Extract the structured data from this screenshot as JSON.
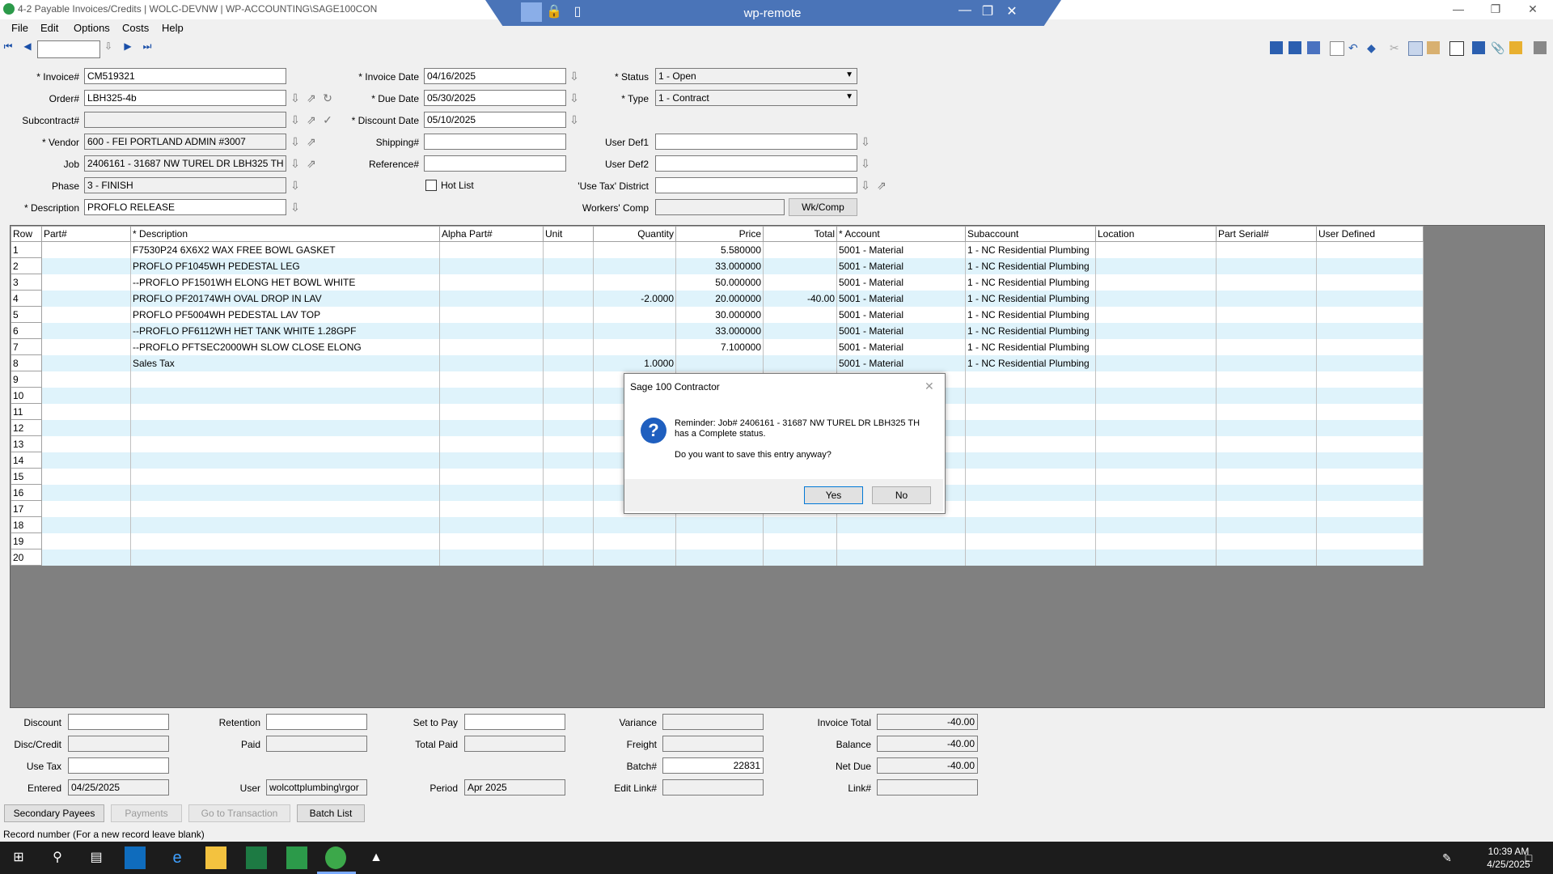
{
  "window": {
    "title": "4-2 Payable Invoices/Credits  |  WOLC-DEVNW  |  WP-ACCOUNTING\\SAGE100CON",
    "remote_title": "wp-remote"
  },
  "menu": [
    "File",
    "Edit",
    "Options",
    "Costs",
    "Help"
  ],
  "icons": {
    "app": "sage-app-icon",
    "nav_first": "first-record-icon",
    "nav_prev": "prev-record-icon",
    "nav_next": "next-record-icon",
    "nav_last": "last-record-icon",
    "lookup": "down-arrow-lookup-icon",
    "accent_color": "#1f5fbf",
    "row_alt_color": "#dff3fb"
  },
  "form": {
    "invoice": {
      "label": "* Invoice#",
      "value": "CM519321"
    },
    "order": {
      "label": "Order#",
      "value": "LBH325-4b"
    },
    "subcontract": {
      "label": "Subcontract#",
      "value": ""
    },
    "vendor": {
      "label": "* Vendor",
      "value": "600 - FEI PORTLAND ADMIN #3007"
    },
    "job": {
      "label": "Job",
      "value": "2406161 - 31687 NW TUREL DR  LBH325 TH"
    },
    "phase": {
      "label": "Phase",
      "value": "3 - FINISH"
    },
    "description": {
      "label": "* Description",
      "value": "PROFLO RELEASE"
    },
    "invoice_date": {
      "label": "* Invoice Date",
      "value": "04/16/2025"
    },
    "due_date": {
      "label": "* Due Date",
      "value": "05/30/2025"
    },
    "discount_date": {
      "label": "* Discount Date",
      "value": "05/10/2025"
    },
    "shipping": {
      "label": "Shipping#",
      "value": ""
    },
    "reference": {
      "label": "Reference#",
      "value": ""
    },
    "hot_list": {
      "label": "Hot List",
      "checked": false
    },
    "status": {
      "label": "* Status",
      "value": "1 - Open"
    },
    "type": {
      "label": "* Type",
      "value": "1 - Contract"
    },
    "user_def1": {
      "label": "User Def1",
      "value": ""
    },
    "user_def2": {
      "label": "User Def2",
      "value": ""
    },
    "use_tax_district": {
      "label": "'Use Tax' District",
      "value": ""
    },
    "workers_comp": {
      "label": "Workers' Comp",
      "value": ""
    },
    "wkcomp_button": "Wk/Comp"
  },
  "grid": {
    "columns": [
      "Row",
      "Part#",
      "* Description",
      "Alpha Part#",
      "Unit",
      "Quantity",
      "Price",
      "Total",
      "* Account",
      "Subaccount",
      "Location",
      "Part Serial#",
      "User Defined"
    ],
    "rows": [
      [
        "1",
        "",
        "F7530P24 6X6X2 WAX FREE BOWL GASKET",
        "",
        "",
        "",
        "5.580000",
        "",
        "5001 - Material",
        "1 - NC Residential Plumbing",
        "",
        "",
        ""
      ],
      [
        "2",
        "",
        "PROFLO PF1045WH PEDESTAL LEG",
        "",
        "",
        "",
        "33.000000",
        "",
        "5001 - Material",
        "1 - NC Residential Plumbing",
        "",
        "",
        ""
      ],
      [
        "3",
        "",
        "--PROFLO PF1501WH ELONG HET BOWL WHITE",
        "",
        "",
        "",
        "50.000000",
        "",
        "5001 - Material",
        "1 - NC Residential Plumbing",
        "",
        "",
        ""
      ],
      [
        "4",
        "",
        "PROFLO PF20174WH OVAL DROP IN LAV",
        "",
        "",
        "-2.0000",
        "20.000000",
        "-40.00",
        "5001 - Material",
        "1 - NC Residential Plumbing",
        "",
        "",
        ""
      ],
      [
        "5",
        "",
        "PROFLO PF5004WH PEDESTAL LAV TOP",
        "",
        "",
        "",
        "30.000000",
        "",
        "5001 - Material",
        "1 - NC Residential Plumbing",
        "",
        "",
        ""
      ],
      [
        "6",
        "",
        "--PROFLO PF6112WH HET TANK WHITE 1.28GPF",
        "",
        "",
        "",
        "33.000000",
        "",
        "5001 - Material",
        "1 - NC Residential Plumbing",
        "",
        "",
        ""
      ],
      [
        "7",
        "",
        "--PROFLO PFTSEC2000WH SLOW CLOSE ELONG",
        "",
        "",
        "",
        "7.100000",
        "",
        "5001 - Material",
        "1 - NC Residential Plumbing",
        "",
        "",
        ""
      ],
      [
        "8",
        "",
        "Sales Tax",
        "",
        "",
        "1.0000",
        "",
        "",
        "5001 - Material",
        "1 - NC Residential Plumbing",
        "",
        "",
        ""
      ],
      [
        "9",
        "",
        "",
        "",
        "",
        "",
        "",
        "",
        "",
        "",
        "",
        "",
        ""
      ],
      [
        "10",
        "",
        "",
        "",
        "",
        "",
        "",
        "",
        "",
        "",
        "",
        "",
        ""
      ],
      [
        "11",
        "",
        "",
        "",
        "",
        "",
        "",
        "",
        "",
        "",
        "",
        "",
        ""
      ],
      [
        "12",
        "",
        "",
        "",
        "",
        "",
        "",
        "",
        "",
        "",
        "",
        "",
        ""
      ],
      [
        "13",
        "",
        "",
        "",
        "",
        "",
        "",
        "",
        "",
        "",
        "",
        "",
        ""
      ],
      [
        "14",
        "",
        "",
        "",
        "",
        "",
        "",
        "",
        "",
        "",
        "",
        "",
        ""
      ],
      [
        "15",
        "",
        "",
        "",
        "",
        "",
        "",
        "",
        "",
        "",
        "",
        "",
        ""
      ],
      [
        "16",
        "",
        "",
        "",
        "",
        "",
        "",
        "",
        "",
        "",
        "",
        "",
        ""
      ],
      [
        "17",
        "",
        "",
        "",
        "",
        "",
        "",
        "",
        "",
        "",
        "",
        "",
        ""
      ],
      [
        "18",
        "",
        "",
        "",
        "",
        "",
        "",
        "",
        "",
        "",
        "",
        "",
        ""
      ],
      [
        "19",
        "",
        "",
        "",
        "",
        "",
        "",
        "",
        "",
        "",
        "",
        "",
        ""
      ],
      [
        "20",
        "",
        "",
        "",
        "",
        "",
        "",
        "",
        "",
        "",
        "",
        "",
        ""
      ]
    ]
  },
  "dialog": {
    "title": "Sage 100 Contractor",
    "message_line1": "Reminder: Job# 2406161 - 31687 NW TUREL DR  LBH325 TH",
    "message_line2": "has a Complete status.",
    "question": "Do you want to save this entry anyway?",
    "yes": "Yes",
    "no": "No"
  },
  "totals": {
    "discount": {
      "label": "Discount",
      "value": ""
    },
    "disc_credit": {
      "label": "Disc/Credit",
      "value": ""
    },
    "use_tax": {
      "label": "Use Tax",
      "value": ""
    },
    "entered": {
      "label": "Entered",
      "value": "04/25/2025"
    },
    "retention": {
      "label": "Retention",
      "value": ""
    },
    "paid": {
      "label": "Paid",
      "value": ""
    },
    "user": {
      "label": "User",
      "value": "wolcottplumbing\\rgor"
    },
    "set_to_pay": {
      "label": "Set to Pay",
      "value": ""
    },
    "total_paid": {
      "label": "Total Paid",
      "value": ""
    },
    "period": {
      "label": "Period",
      "value": "Apr 2025"
    },
    "variance": {
      "label": "Variance",
      "value": ""
    },
    "freight": {
      "label": "Freight",
      "value": ""
    },
    "batch": {
      "label": "Batch#",
      "value": "22831"
    },
    "edit_link": {
      "label": "Edit Link#",
      "value": ""
    },
    "invoice_total": {
      "label": "Invoice Total",
      "value": "-40.00"
    },
    "balance": {
      "label": "Balance",
      "value": "-40.00"
    },
    "net_due": {
      "label": "Net Due",
      "value": "-40.00"
    },
    "link": {
      "label": "Link#",
      "value": ""
    }
  },
  "buttons": {
    "secondary_payees": "Secondary Payees",
    "payments": "Payments",
    "go_to_transaction": "Go to Transaction",
    "batch_list": "Batch List"
  },
  "status_text": "Record number (For a new record leave blank)",
  "clock": {
    "time": "10:39 AM",
    "date": "4/25/2025"
  }
}
